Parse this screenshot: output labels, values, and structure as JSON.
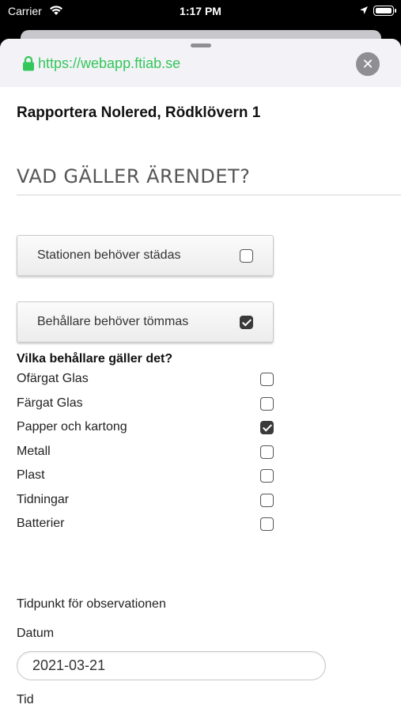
{
  "status_bar": {
    "carrier": "Carrier",
    "time": "1:17 PM",
    "icons": [
      "wifi-icon",
      "location-icon",
      "battery-icon"
    ]
  },
  "browser": {
    "url": "https://webapp.ftiab.se",
    "close_symbol": "✕",
    "url_color": "#34c759"
  },
  "page": {
    "title": "Rapportera Nolered, Rödklövern 1",
    "section_heading": "VAD GÄLLER ÄRENDET?"
  },
  "options": [
    {
      "label": "Stationen behöver städas",
      "checked": false
    },
    {
      "label": "Behållare behöver tömmas",
      "checked": true
    }
  ],
  "containers": {
    "question": "Vilka behållare gäller det?",
    "items": [
      {
        "label": "Ofärgat Glas",
        "checked": false
      },
      {
        "label": "Färgat Glas",
        "checked": false
      },
      {
        "label": "Papper och kartong",
        "checked": true
      },
      {
        "label": "Metall",
        "checked": false
      },
      {
        "label": "Plast",
        "checked": false
      },
      {
        "label": "Tidningar",
        "checked": false
      },
      {
        "label": "Batterier",
        "checked": false
      }
    ]
  },
  "observation": {
    "label": "Tidpunkt för observationen",
    "date_label": "Datum",
    "date_value": "2021-03-21",
    "time_label": "Tid"
  }
}
